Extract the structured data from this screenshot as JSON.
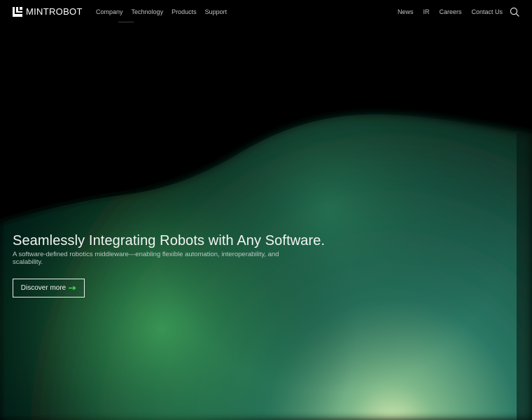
{
  "brand": {
    "name": "MINTROBOT",
    "logo_icon": "mintrobot-logo-icon"
  },
  "nav": {
    "primary": [
      {
        "label": "Company"
      },
      {
        "label": "Technology"
      },
      {
        "label": "Products"
      },
      {
        "label": "Support"
      }
    ],
    "secondary": [
      {
        "label": "News"
      },
      {
        "label": "IR"
      },
      {
        "label": "Careers"
      },
      {
        "label": "Contact Us"
      }
    ],
    "search_icon": "search-icon"
  },
  "hero": {
    "title": "Seamlessly Integrating Robots with Any Software.",
    "subtitle": "A software-defined robotics middleware—enabling flexible automation, interoperability, and scalability.",
    "cta_label": "Discover more",
    "cta_icon": "arrow-right-icon"
  },
  "colors": {
    "background": "#000000",
    "glow_green": "#2f8f52",
    "glow_teal": "#1f6a60",
    "glow_light": "#c9e3a8",
    "accent_arrow": "#4fd35e",
    "text": "#f2f4f3",
    "nav_text": "#bfc4c2"
  }
}
